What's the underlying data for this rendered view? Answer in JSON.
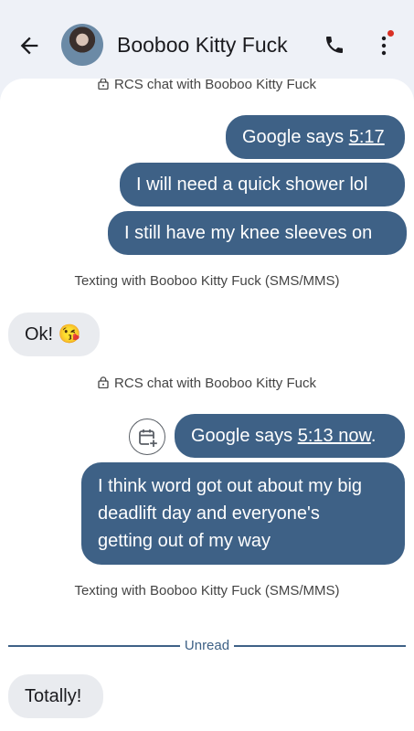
{
  "header": {
    "contact_name": "Booboo Kitty Fuck",
    "back_icon": "arrow-left-icon",
    "call_icon": "phone-icon",
    "menu_icon": "more-vert-icon",
    "notification_dot_color": "#d93025"
  },
  "conversation": {
    "rcs_label_top": "RCS chat with Booboo Kitty Fuck",
    "messages_1": [
      {
        "prefix": "Google says ",
        "link": "5:17",
        "suffix": ""
      },
      {
        "text": "I will need a quick shower lol"
      },
      {
        "text": "I still have my knee sleeves on"
      }
    ],
    "sms_label_1": "Texting with Booboo Kitty Fuck (SMS/MMS)",
    "incoming_1": "Ok! 😘",
    "rcs_label_2": "RCS chat with Booboo Kitty Fuck",
    "messages_2": [
      {
        "prefix": "Google says ",
        "link": "5:13 now",
        "suffix": "."
      },
      {
        "lines": [
          "I think word got out about my big",
          "deadlift day and everyone's",
          "getting out of my way"
        ]
      }
    ],
    "sms_label_2": "Texting with Booboo Kitty Fuck (SMS/MMS)",
    "unread_label": "Unread",
    "incoming_2": "Totally!"
  },
  "colors": {
    "outgoing_bubble": "#3e6186",
    "incoming_bubble": "#e9ebef",
    "background": "#eef1f7"
  }
}
